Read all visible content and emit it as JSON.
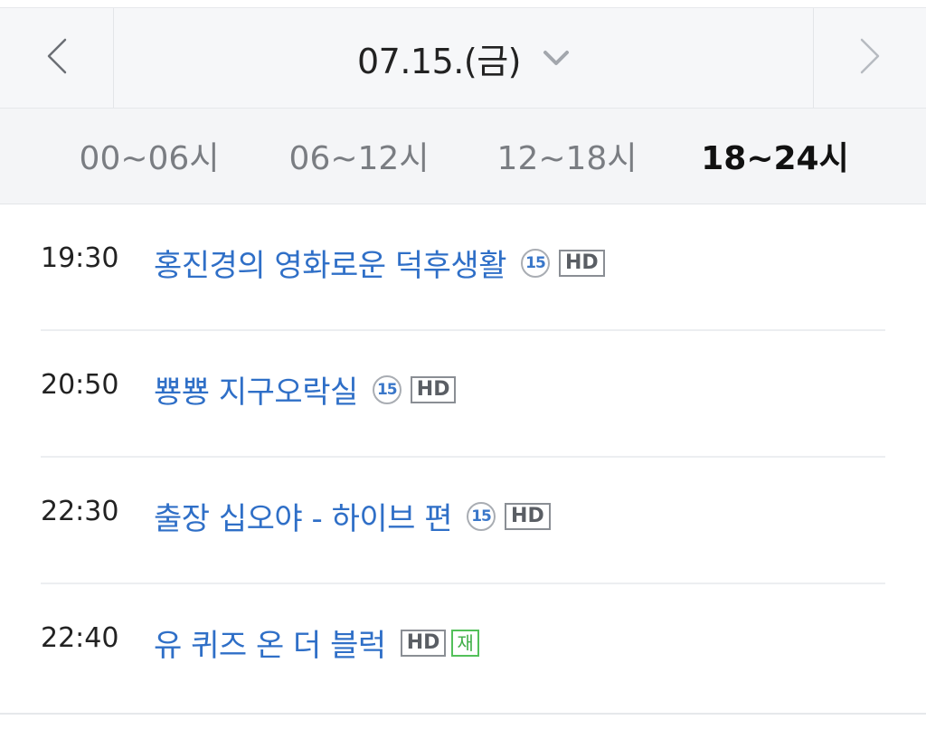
{
  "date_nav": {
    "date_label": "07.15.(금)",
    "prev_icon": "chevron-left-icon",
    "next_icon": "chevron-right-icon",
    "dropdown_icon": "chevron-down-icon"
  },
  "time_tabs": [
    {
      "label": "00~06시",
      "active": false
    },
    {
      "label": "06~12시",
      "active": false
    },
    {
      "label": "12~18시",
      "active": false
    },
    {
      "label": "18~24시",
      "active": true
    }
  ],
  "schedule": [
    {
      "time": "19:30",
      "title": "홍진경의 영화로운 덕후생활",
      "age_rating": "15",
      "hd": "HD",
      "rerun": ""
    },
    {
      "time": "20:50",
      "title": "뿅뿅 지구오락실",
      "age_rating": "15",
      "hd": "HD",
      "rerun": ""
    },
    {
      "time": "22:30",
      "title": "출장 십오야 - 하이브 편",
      "age_rating": "15",
      "hd": "HD",
      "rerun": ""
    },
    {
      "time": "22:40",
      "title": "유 퀴즈 온 더 블럭",
      "age_rating": "",
      "hd": "HD",
      "rerun": "재"
    }
  ],
  "colors": {
    "title_blue": "#2f6fc7",
    "rerun_green": "#3fae47",
    "active_tab": "#111111",
    "inactive_tab": "#7a7d82"
  }
}
